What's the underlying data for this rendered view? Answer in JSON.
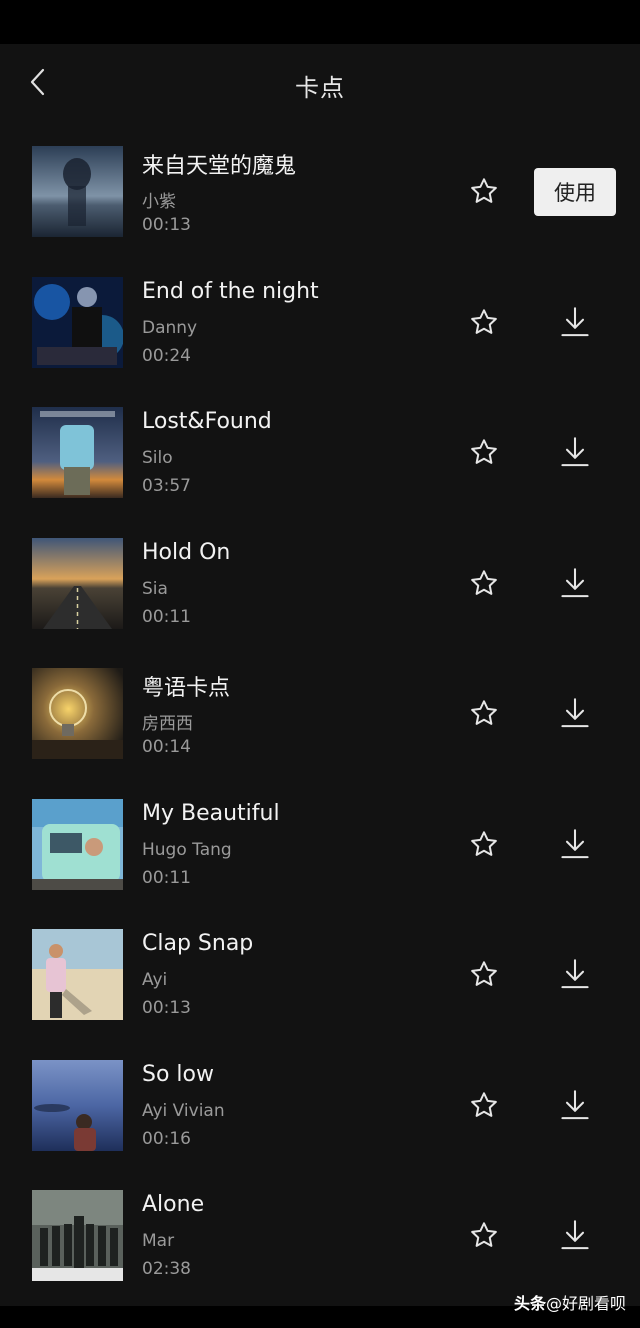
{
  "header": {
    "title": "卡点",
    "back_icon": "chevron-left-icon"
  },
  "actions": {
    "use_label": "使用",
    "favorite_icon": "star-outline-icon",
    "download_icon": "download-icon"
  },
  "songs": [
    {
      "title": "来自天堂的魔鬼",
      "artist": "小紫",
      "duration": "00:13",
      "action": "use"
    },
    {
      "title": "End of the night",
      "artist": "Danny",
      "duration": "00:24",
      "action": "download"
    },
    {
      "title": "Lost&Found",
      "artist": "Silo",
      "duration": "03:57",
      "action": "download"
    },
    {
      "title": "Hold On",
      "artist": "Sia",
      "duration": "00:11",
      "action": "download"
    },
    {
      "title": "粤语卡点",
      "artist": "房西西",
      "duration": "00:14",
      "action": "download"
    },
    {
      "title": "My Beautiful",
      "artist": "Hugo Tang",
      "duration": "00:11",
      "action": "download"
    },
    {
      "title": "Clap Snap",
      "artist": "Ayi",
      "duration": "00:13",
      "action": "download"
    },
    {
      "title": "So low",
      "artist": "Ayi Vivian",
      "duration": "00:16",
      "action": "download"
    },
    {
      "title": "Alone",
      "artist": "Mar",
      "duration": "02:38",
      "action": "download"
    }
  ],
  "watermark": {
    "brand": "头条",
    "handle": "@好剧看呗"
  },
  "colors": {
    "background": "#121212",
    "title_text": "#f2f2f2",
    "secondary_text": "#9a9a9a",
    "use_button_bg": "#efefef"
  }
}
